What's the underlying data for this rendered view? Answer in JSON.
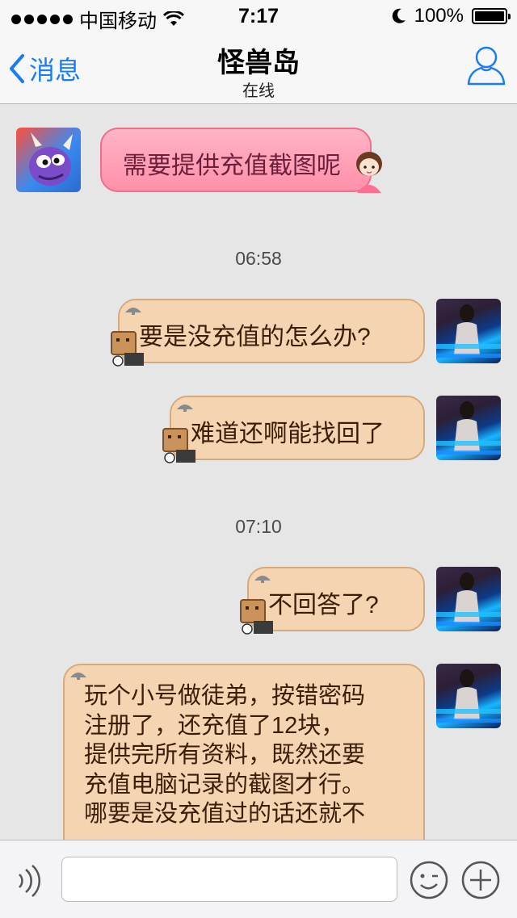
{
  "status_bar": {
    "carrier": "中国移动",
    "time": "7:17",
    "battery": "100%"
  },
  "nav": {
    "back_label": "消息",
    "title": "怪兽岛",
    "subtitle": "在线"
  },
  "messages": [
    {
      "side": "in",
      "text": "需要提供充值截图呢"
    },
    {
      "side": "out",
      "text": "要是没充值的怎么办?"
    },
    {
      "side": "out",
      "text": "难道还啊能找回了"
    },
    {
      "side": "out",
      "text": "不回答了?"
    },
    {
      "side": "out",
      "lines": [
        "玩个小号做徒弟，按错密码",
        "注册了，还充值了12块，",
        "提供完所有资料，既然还要",
        "充值电脑记录的截图才行。",
        "哪要是没充值过的话还就不"
      ]
    }
  ],
  "timestamps": [
    "06:58",
    "07:10"
  ],
  "input": {
    "placeholder": ""
  },
  "colors": {
    "accent": "#1a7cf5",
    "incoming_bubble": "#ff9fb5",
    "outgoing_bubble": "#f5d4b2"
  },
  "icons": {
    "back": "chevron-left-icon",
    "contact": "person-icon",
    "voice": "voice-icon",
    "emoji": "smiley-icon",
    "plus": "plus-icon"
  }
}
